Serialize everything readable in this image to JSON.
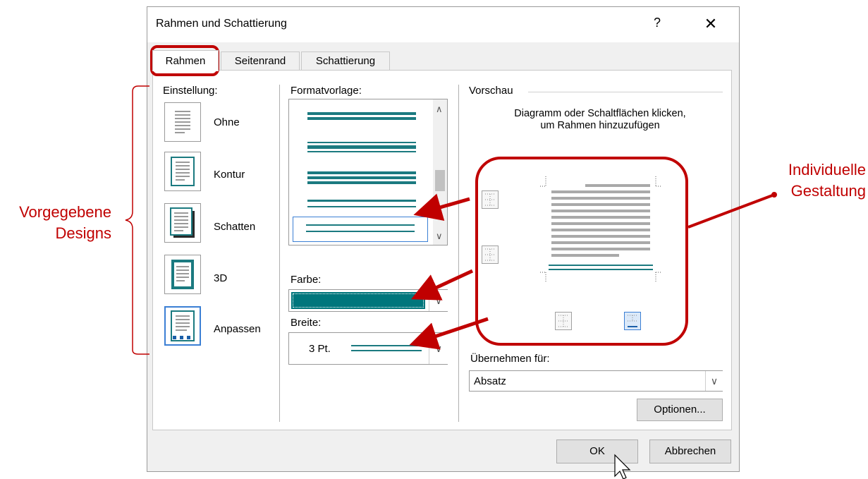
{
  "dialog": {
    "title": "Rahmen und Schattierung",
    "help_label": "?",
    "close_label": "✕",
    "tabs": [
      {
        "label": "Rahmen",
        "active": true
      },
      {
        "label": "Seitenrand",
        "active": false
      },
      {
        "label": "Schattierung",
        "active": false
      }
    ]
  },
  "settings": {
    "heading": "Einstellung:",
    "items": [
      {
        "label": "Ohne",
        "icon": "none-border-icon"
      },
      {
        "label": "Kontur",
        "icon": "box-border-icon"
      },
      {
        "label": "Schatten",
        "icon": "shadow-border-icon"
      },
      {
        "label": "3D",
        "icon": "3d-border-icon"
      },
      {
        "label": "Anpassen",
        "icon": "custom-border-icon",
        "selected": true
      }
    ]
  },
  "style": {
    "heading": "Formatvorlage:",
    "color_label": "Farbe:",
    "color_value": "#00767c",
    "width_label": "Breite:",
    "width_value": "3 Pt."
  },
  "preview": {
    "heading": "Vorschau",
    "hint": "Diagramm oder Schaltflächen klicken, um Rahmen hinzuzufügen",
    "apply_label": "Übernehmen für:",
    "apply_value": "Absatz",
    "options_label": "Optionen..."
  },
  "footer": {
    "ok_label": "OK",
    "cancel_label": "Abbrechen"
  },
  "annotations": {
    "left_label": "Vorgegebene Designs",
    "right_label": "Individuelle Gestaltung",
    "accent_color": "#c00000"
  }
}
